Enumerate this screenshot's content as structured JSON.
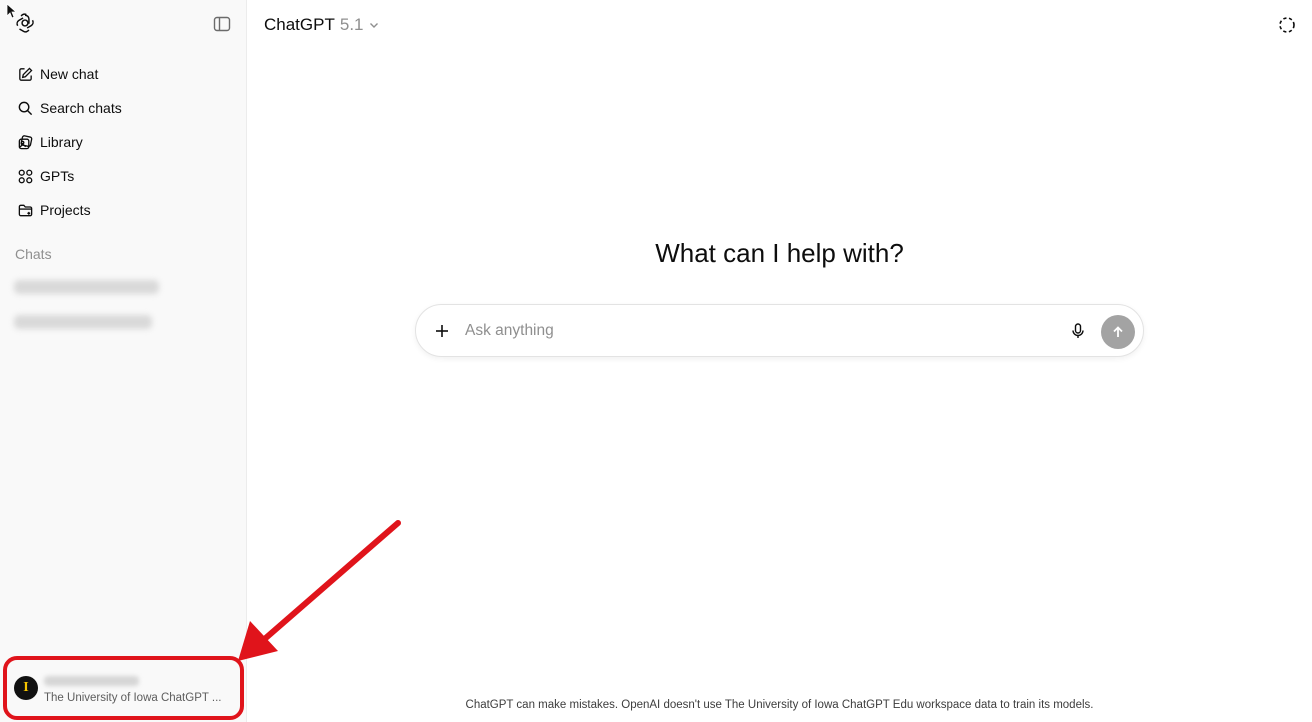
{
  "sidebar": {
    "items": [
      {
        "label": "New chat",
        "icon": "edit-icon"
      },
      {
        "label": "Search chats",
        "icon": "search-icon"
      },
      {
        "label": "Library",
        "icon": "library-icon"
      },
      {
        "label": "GPTs",
        "icon": "grid-icon"
      },
      {
        "label": "Projects",
        "icon": "folder-icon"
      }
    ],
    "chats_label": "Chats",
    "account": {
      "avatar_letter": "I",
      "workspace": "The University of Iowa ChatGPT ..."
    }
  },
  "header": {
    "title": "ChatGPT",
    "version": "5.1"
  },
  "main": {
    "headline": "What can I help with?",
    "composer": {
      "placeholder": "Ask anything",
      "value": ""
    }
  },
  "footer": {
    "disclaimer": "ChatGPT can make mistakes. OpenAI doesn't use The University of Iowa ChatGPT Edu workspace data to train its models."
  },
  "colors": {
    "annotation": "#e0141b",
    "sidebar_bg": "#f9f9f9",
    "send_button": "#a3a3a3"
  }
}
